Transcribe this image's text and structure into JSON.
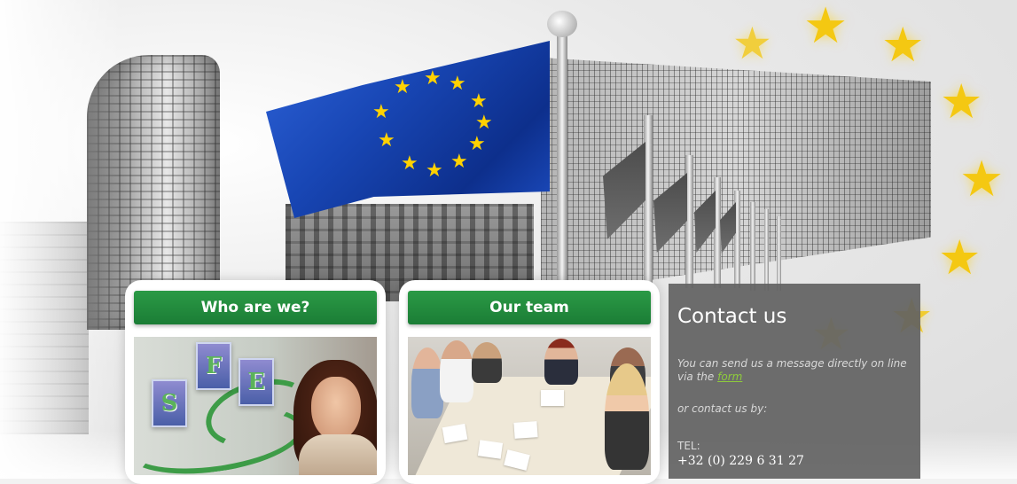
{
  "cards": [
    {
      "title": "Who are we?"
    },
    {
      "title": "Our team"
    }
  ],
  "sfe_logo": {
    "letters": [
      "S",
      "F",
      "E"
    ]
  },
  "contact": {
    "title": "Contact us",
    "message_prefix": "You can send us a message directly on line via the",
    "form_link": "form",
    "or_text": "or contact us by:",
    "tel_label": "TEL:",
    "tel_number": "+32 (0) 229 6 31 27"
  },
  "icons": {
    "hero": "eu-flag-icon",
    "decor": "star-icon"
  },
  "colors": {
    "header_green": "#1b7d36",
    "contact_panel": "#626262",
    "link_green": "#8ecb3c",
    "eu_blue": "#1846b4",
    "star_gold": "#f4c812"
  }
}
